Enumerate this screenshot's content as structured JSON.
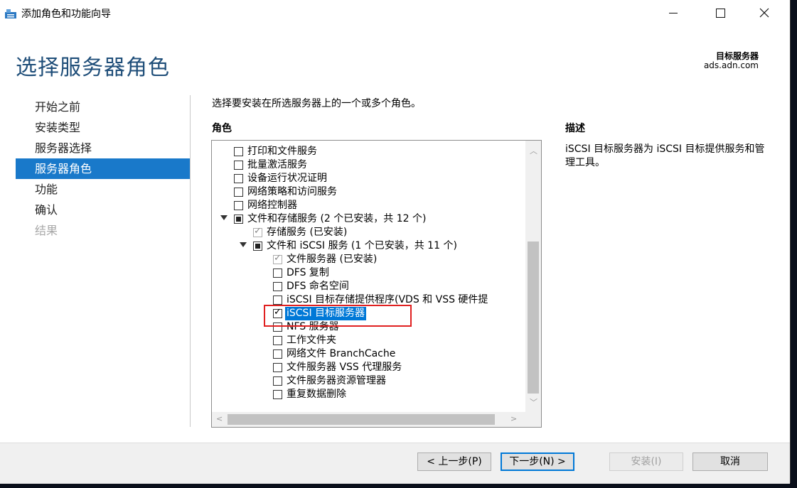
{
  "window": {
    "title": "添加角色和功能向导",
    "minimize_glyph": "—",
    "maximize_glyph": "☐",
    "close_glyph": "✕"
  },
  "header": {
    "page_title": "选择服务器角色",
    "target_label": "目标服务器",
    "target_host": "ads.adn.com"
  },
  "nav": {
    "items": [
      {
        "label": "开始之前",
        "state": "normal"
      },
      {
        "label": "安装类型",
        "state": "normal"
      },
      {
        "label": "服务器选择",
        "state": "normal"
      },
      {
        "label": "服务器角色",
        "state": "active"
      },
      {
        "label": "功能",
        "state": "normal"
      },
      {
        "label": "确认",
        "state": "normal"
      },
      {
        "label": "结果",
        "state": "disabled"
      }
    ]
  },
  "main": {
    "instruction": "选择要安装在所选服务器上的一个或多个角色。",
    "roles_heading": "角色",
    "description_heading": "描述",
    "description_text": "iSCSI 目标服务器为 iSCSI 目标提供服务和管理工具。",
    "roles": [
      {
        "label": "打印和文件服务",
        "level": 0,
        "state": "unchecked"
      },
      {
        "label": "批量激活服务",
        "level": 0,
        "state": "unchecked"
      },
      {
        "label": "设备运行状况证明",
        "level": 0,
        "state": "unchecked"
      },
      {
        "label": "网络策略和访问服务",
        "level": 0,
        "state": "unchecked"
      },
      {
        "label": "网络控制器",
        "level": 0,
        "state": "unchecked"
      },
      {
        "label": "文件和存储服务 (2 个已安装，共 12 个)",
        "level": 0,
        "state": "partial",
        "expander": true
      },
      {
        "label": "存储服务 (已安装)",
        "level": 1,
        "state": "checked-grey"
      },
      {
        "label": "文件和 iSCSI 服务 (1 个已安装，共 11 个)",
        "level": 1,
        "state": "partial",
        "expander": true
      },
      {
        "label": "文件服务器 (已安装)",
        "level": 2,
        "state": "checked-grey"
      },
      {
        "label": "DFS 复制",
        "level": 2,
        "state": "unchecked"
      },
      {
        "label": "DFS 命名空间",
        "level": 2,
        "state": "unchecked"
      },
      {
        "label": "iSCSI 目标存储提供程序(VDS 和 VSS 硬件提",
        "level": 2,
        "state": "unchecked"
      },
      {
        "label": "iSCSI 目标服务器",
        "level": 2,
        "state": "checked",
        "selected": true
      },
      {
        "label": "NFS 服务器",
        "level": 2,
        "state": "unchecked"
      },
      {
        "label": "工作文件夹",
        "level": 2,
        "state": "unchecked"
      },
      {
        "label": "网络文件 BranchCache",
        "level": 2,
        "state": "unchecked"
      },
      {
        "label": "文件服务器 VSS 代理服务",
        "level": 2,
        "state": "unchecked"
      },
      {
        "label": "文件服务器资源管理器",
        "level": 2,
        "state": "unchecked"
      },
      {
        "label": "重复数据删除",
        "level": 2,
        "state": "unchecked"
      }
    ]
  },
  "footer": {
    "prev_label": "< 上一步(P)",
    "next_label": "下一步(N) >",
    "install_label": "安装(I)",
    "cancel_label": "取消"
  },
  "colors": {
    "accent": "#1979ca",
    "title_blue": "#1f4e79",
    "highlight_red": "#e02020",
    "selection_blue": "#0078d7"
  }
}
